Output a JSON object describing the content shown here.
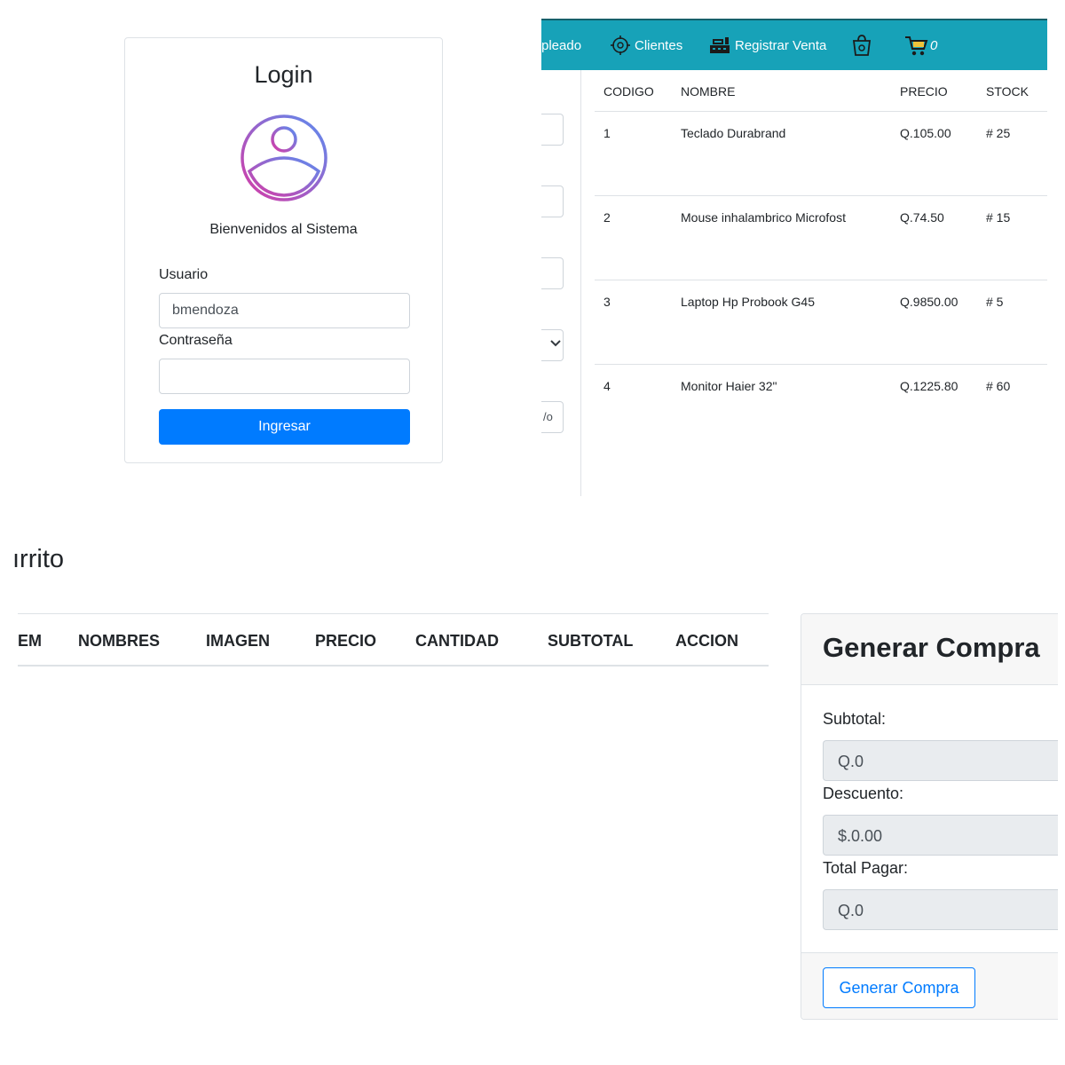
{
  "login": {
    "title": "Login",
    "welcome": "Bienvenidos al Sistema",
    "user_label": "Usuario",
    "user_value": "bmendoza",
    "password_label": "Contraseña",
    "password_value": "",
    "submit_label": "Ingresar",
    "avatar_icon": "user-circle-icon"
  },
  "navbar": {
    "items": [
      {
        "label": "pleado"
      },
      {
        "label": "Clientes",
        "icon": "target-icon"
      },
      {
        "label": "Registrar Venta",
        "icon": "cash-register-icon"
      },
      {
        "label": "",
        "icon": "shopping-bag-icon"
      },
      {
        "label": "0",
        "icon": "shopping-cart-icon"
      }
    ]
  },
  "left_form": {
    "partial_text": "/o"
  },
  "products": {
    "headers": [
      "CODIGO",
      "NOMBRE",
      "PRECIO",
      "STOCK"
    ],
    "rows": [
      {
        "codigo": "1",
        "nombre": "Teclado Durabrand",
        "precio": "Q.105.00",
        "stock": "# 25"
      },
      {
        "codigo": "2",
        "nombre": "Mouse inhalambrico Microfost",
        "precio": "Q.74.50",
        "stock": "# 15"
      },
      {
        "codigo": "3",
        "nombre": "Laptop Hp Probook G45",
        "precio": "Q.9850.00",
        "stock": "# 5"
      },
      {
        "codigo": "4",
        "nombre": "Monitor Haier 32\"",
        "precio": "Q.1225.80",
        "stock": "# 60"
      }
    ]
  },
  "cart": {
    "title": "ırrito",
    "headers": [
      "EM",
      "NOMBRES",
      "IMAGEN",
      "PRECIO",
      "CANTIDAD",
      "SUBTOTAL",
      "ACCION"
    ]
  },
  "purchase": {
    "title": "Generar Compra",
    "subtotal_label": "Subtotal:",
    "subtotal_value": "Q.0",
    "discount_label": "Descuento:",
    "discount_value": "$.0.00",
    "total_label": "Total Pagar:",
    "total_value": "Q.0",
    "button_label": "Generar Compra"
  },
  "colors": {
    "primary": "#007bff",
    "navbar": "#17a2b8",
    "border": "#dee2e6"
  }
}
